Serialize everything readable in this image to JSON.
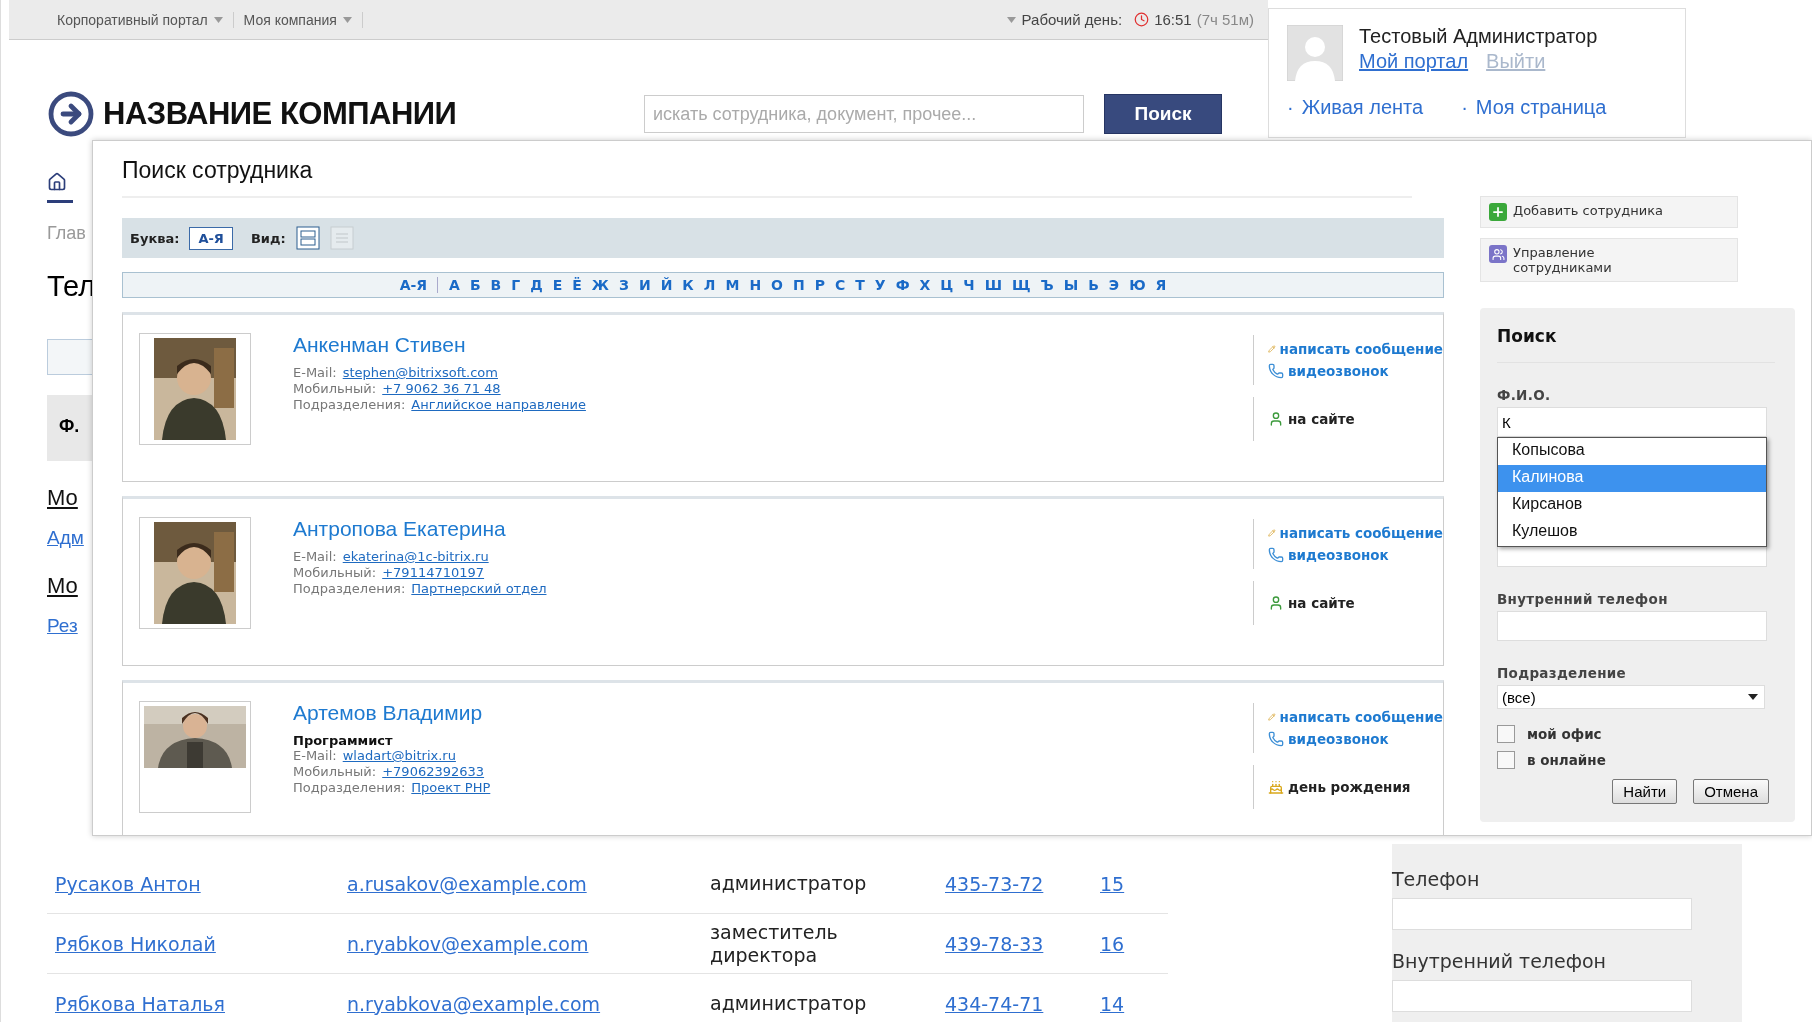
{
  "top_bar": {
    "menus": [
      {
        "label": "Корпоративный портал"
      },
      {
        "label": "Моя компания"
      }
    ],
    "workday_label": "Рабочий день:",
    "time": "16:51",
    "duration": "(7ч 51м)"
  },
  "user_panel": {
    "name": "Тестовый Администратор",
    "links": [
      {
        "label": "Мой портал",
        "disabled": false
      },
      {
        "label": "Выйти",
        "disabled": true
      }
    ],
    "menu": [
      {
        "bullet": "·",
        "label": "Живая лента"
      },
      {
        "bullet": "·",
        "label": "Моя страница"
      }
    ]
  },
  "header": {
    "company": "НАЗВАНИЕ КОМПАНИИ",
    "search": {
      "placeholder": "искать сотрудника, документ, прочее..."
    },
    "search_button": "Поиск"
  },
  "background_left": [
    {
      "kind": "home",
      "text": "Глав"
    },
    {
      "kind": "heading",
      "text": "Тел"
    },
    {
      "kind": "field"
    },
    {
      "kind": "column",
      "text": "Ф."
    },
    {
      "kind": "section",
      "text": "Мо"
    },
    {
      "kind": "link",
      "text": "Адм"
    },
    {
      "kind": "section",
      "text": "Мо"
    },
    {
      "kind": "link",
      "text": "Рез"
    }
  ],
  "dialog": {
    "title": "Поиск сотрудника",
    "letter_label": "Буква:",
    "letter_mode": "А-Я",
    "view_label": "Вид:",
    "views": [
      {
        "selected": true
      },
      {
        "selected": false
      }
    ],
    "all_letters": "А-Я",
    "letters": [
      "А",
      "Б",
      "В",
      "Г",
      "Д",
      "Е",
      "Ё",
      "Ж",
      "З",
      "И",
      "Й",
      "К",
      "Л",
      "М",
      "Н",
      "О",
      "П",
      "Р",
      "С",
      "Т",
      "У",
      "Ф",
      "Х",
      "Ц",
      "Ч",
      "Ш",
      "Щ",
      "Ъ",
      "Ы",
      "Ь",
      "Э",
      "Ю",
      "Я"
    ],
    "employees": [
      {
        "name": "Анкенман Стивен",
        "fields": [
          {
            "label": "E-Mail:",
            "value": "stephen@bitrixsoft.com"
          },
          {
            "label": "Мобильный:",
            "value": "+7 9062 36 71 48"
          },
          {
            "label": "Подразделения:",
            "value": "Английское направление"
          }
        ],
        "actions": [
          {
            "kind": "message",
            "label": "написать сообщение"
          },
          {
            "kind": "video",
            "label": "видеозвонок"
          }
        ],
        "status": {
          "kind": "online",
          "label": "на сайте"
        }
      },
      {
        "name": "Антропова Екатерина",
        "fields": [
          {
            "label": "E-Mail:",
            "value": "ekaterina@1c-bitrix.ru"
          },
          {
            "label": "Мобильный:",
            "value": "+79114710197"
          },
          {
            "label": "Подразделения:",
            "value": "Партнерский отдел"
          }
        ],
        "actions": [
          {
            "kind": "message",
            "label": "написать сообщение"
          },
          {
            "kind": "video",
            "label": "видеозвонок"
          }
        ],
        "status": {
          "kind": "online",
          "label": "на сайте"
        }
      },
      {
        "name": "Артемов Владимир",
        "position": "Программист",
        "fields": [
          {
            "label": "E-Mail:",
            "value": "wladart@bitrix.ru"
          },
          {
            "label": "Мобильный:",
            "value": "+79062392633"
          },
          {
            "label": "Подразделения:",
            "value": "Проект PHP"
          }
        ],
        "actions": [
          {
            "kind": "message",
            "label": "написать сообщение"
          },
          {
            "kind": "video",
            "label": "видеозвонок"
          }
        ],
        "status": {
          "kind": "birthday",
          "label": "день рождения"
        }
      }
    ],
    "buttons": [
      {
        "kind": "add",
        "label": "Добавить сотрудника"
      },
      {
        "kind": "manage",
        "label": "Управление сотрудниками"
      }
    ],
    "search_panel": {
      "title": "Поиск",
      "name_label": "Ф.И.О.",
      "name_value": "К",
      "suggestions": [
        {
          "label": "Копысова",
          "selected": false
        },
        {
          "label": "Калинова",
          "selected": true
        },
        {
          "label": "Кирсанов",
          "selected": false
        },
        {
          "label": "Кулешов",
          "selected": false
        }
      ],
      "phone_label": "Внутренний телефон",
      "department_label": "Подразделение",
      "department_value": "(все)",
      "checks": [
        {
          "label": "мой офис",
          "checked": false
        },
        {
          "label": "в онлайне",
          "checked": false
        }
      ],
      "find_button": "Найти",
      "cancel_button": "Отмена"
    }
  },
  "table": {
    "rows": [
      {
        "name": "Русаков Антон",
        "email": "a.rusakov@example.com",
        "role": "администратор",
        "phone": "435-73-72",
        "number": "15"
      },
      {
        "name": "Рябков Николай",
        "email": "n.ryabkov@example.com",
        "role": "заместитель директора",
        "phone": "439-78-33",
        "number": "16"
      },
      {
        "name": "Рябкова Наталья",
        "email": "n.ryabkova@example.com",
        "role": "администратор",
        "phone": "434-74-71",
        "number": "14"
      }
    ]
  },
  "sidebar": {
    "fields": [
      {
        "label": "Телефон"
      },
      {
        "label": "Внутренний телефон"
      }
    ]
  }
}
